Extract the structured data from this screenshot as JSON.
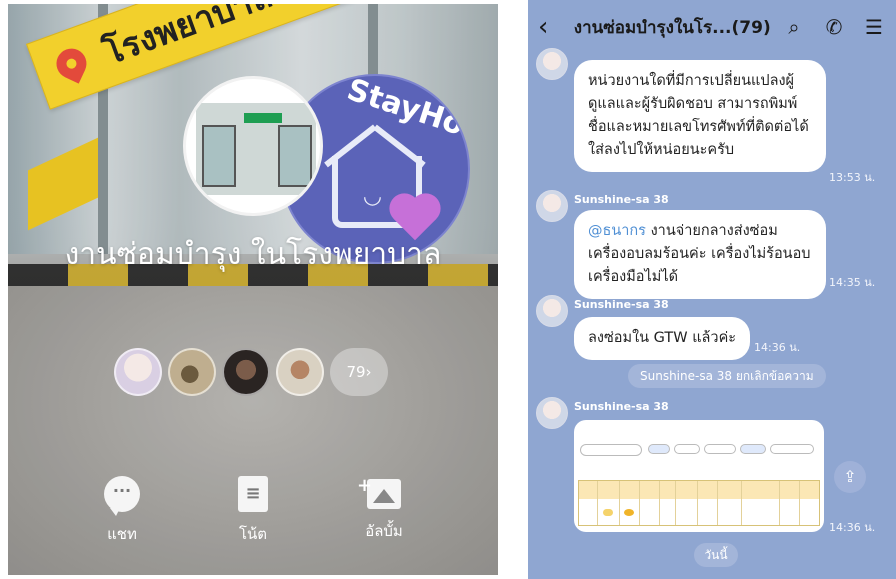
{
  "left_panel": {
    "banner_text": "โรงพยาบาล",
    "badge_text": "StayHome",
    "group_title": "งานซ่อมบำรุง ในโรงพยาบาล",
    "more_members": "79›",
    "actions": [
      {
        "label": "แชท"
      },
      {
        "label": "โน้ต"
      },
      {
        "label": "อัลบั้ม"
      }
    ]
  },
  "chat": {
    "header": {
      "back": "‹",
      "title": "งานซ่อมบำรุงในโร...(79)"
    },
    "messages": [
      {
        "text": "หน่วยงานใดที่มีการเปลี่ยนแปลงผู้ดูแลและผู้รับผิดชอบ สามารถพิมพ์ชื่อและหมายเลขโทรศัพท์ที่ติดต่อได้ใส่ลงไปให้หน่อยนะครับ",
        "time": "13:53 น."
      },
      {
        "sender": "Sunshine-sa 38",
        "mention": "@ธนากร",
        "text": " งานจ่ายกลางส่งซ่อมเครื่องอบลมร้อนค่ะ เครื่องไม่ร้อนอบเครื่องมือไม่ได้",
        "time": "14:35 น."
      },
      {
        "sender": "Sunshine-sa 38",
        "text": "ลงซ่อมใน GTW แล้วค่ะ",
        "time": "14:36 น."
      },
      {
        "sender": "Sunshine-sa 38",
        "time": "14:36 น."
      }
    ],
    "system_message": "Sunshine-sa 38 ยกเลิกข้อความ",
    "date_chip": "วันนี้"
  },
  "colors": {
    "chat_bg": "#8fa6d1",
    "banner_yellow": "#f2d02c",
    "stayhome_purple": "#5b63b8",
    "mention_blue": "#4f8fd4"
  }
}
